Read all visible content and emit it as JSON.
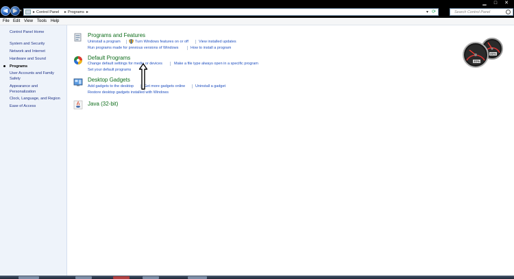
{
  "address_bar": {
    "crumbs": [
      "Control Panel",
      "Programs"
    ]
  },
  "search": {
    "placeholder": "Search Control Panel"
  },
  "window_buttons": {
    "minimize": "▁",
    "maximize": "□",
    "close": "✕"
  },
  "menu": [
    "File",
    "Edit",
    "View",
    "Tools",
    "Help"
  ],
  "sidebar": {
    "items": [
      {
        "label": "Control Panel Home",
        "active": false
      },
      {
        "label": "System and Security",
        "active": false
      },
      {
        "label": "Network and Internet",
        "active": false
      },
      {
        "label": "Hardware and Sound",
        "active": false
      },
      {
        "label": "Programs",
        "active": true
      },
      {
        "label": "User Accounts and Family Safety",
        "active": false
      },
      {
        "label": "Appearance and Personalization",
        "active": false
      },
      {
        "label": "Clock, Language, and Region",
        "active": false
      },
      {
        "label": "Ease of Access",
        "active": false
      }
    ]
  },
  "sections": {
    "programs_features": {
      "title": "Programs and Features",
      "links": [
        "Uninstall a program",
        "Turn Windows features on or off",
        "View installed updates",
        "Run programs made for previous versions of Windows",
        "How to install a program"
      ]
    },
    "default_programs": {
      "title": "Default Programs",
      "links": [
        "Change default settings for media or devices",
        "Make a file type always open in a specific program",
        "Set your default programs"
      ]
    },
    "desktop_gadgets": {
      "title": "Desktop Gadgets",
      "links": [
        "Add gadgets to the desktop",
        "Get more gadgets online",
        "Uninstall a gadget",
        "Restore desktop gadgets installed with Windows"
      ]
    },
    "java": {
      "title": "Java (32-bit)"
    }
  },
  "gadget": {
    "cpu_readout": "20%",
    "mem_readout": "45%"
  },
  "colors": {
    "section_title": "#0d6c1a",
    "link": "#1f4fbf",
    "sidebar_bg": "#eef3fa"
  }
}
